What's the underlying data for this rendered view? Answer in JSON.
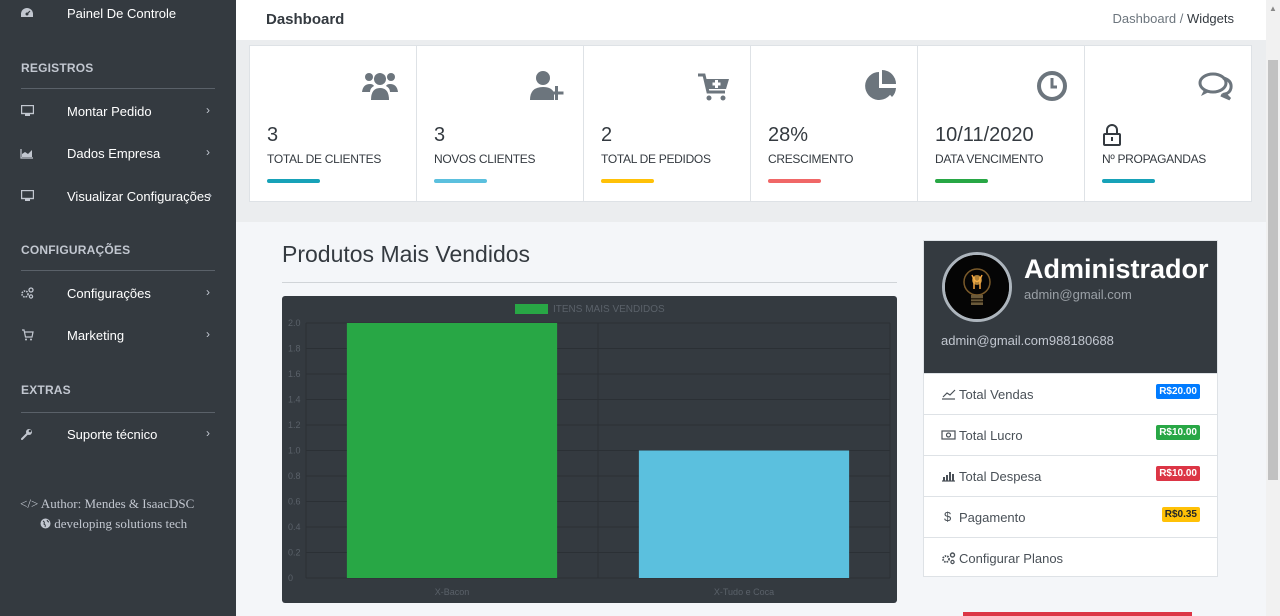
{
  "sidebar": {
    "top_item": {
      "label": "Painel De Controle",
      "icon": "dashboard-icon"
    },
    "sections": [
      {
        "title": "REGISTROS",
        "items": [
          {
            "label": "Montar Pedido",
            "icon": "desktop-icon"
          },
          {
            "label": "Dados Empresa",
            "icon": "area-chart-icon"
          },
          {
            "label": "Visualizar Configurações",
            "icon": "desktop-icon"
          }
        ]
      },
      {
        "title": "CONFIGURAÇÕES",
        "items": [
          {
            "label": "Configurações",
            "icon": "cogs-icon"
          },
          {
            "label": "Marketing",
            "icon": "cart-icon"
          }
        ]
      },
      {
        "title": "EXTRAS",
        "items": [
          {
            "label": "Suporte técnico",
            "icon": "wrench-icon"
          }
        ]
      }
    ],
    "chevron": "›",
    "author_line1": "</> Author: Mendes & IsaacDSC",
    "author_line2": "developing solutions tech"
  },
  "header": {
    "title": "Dashboard",
    "breadcrumb": [
      "Dashboard",
      "/",
      "Widgets"
    ]
  },
  "stats": [
    {
      "value": "3",
      "label": "TOTAL DE CLIENTES",
      "icon": "users-icon",
      "color": "#17a2b8"
    },
    {
      "value": "3",
      "label": "NOVOS CLIENTES",
      "icon": "user-plus-icon",
      "color": "#5bc0de"
    },
    {
      "value": "2",
      "label": "TOTAL DE PEDIDOS",
      "icon": "cart-plus-icon",
      "color": "#ffc107"
    },
    {
      "value": "28%",
      "label": "CRESCIMENTO",
      "icon": "pie-chart-icon",
      "color": "#f06767"
    },
    {
      "value": "10/11/2020",
      "label": "DATA VENCIMENTO",
      "icon": "clock-icon",
      "color": "#28a745"
    },
    {
      "value": "",
      "label": "Nº PROPAGANDAS",
      "icon": "comments-icon",
      "color": "#17a2b8"
    }
  ],
  "panel": {
    "title": "Produtos Mais Vendidos"
  },
  "chart_data": {
    "type": "bar",
    "categories": [
      "X-Bacon",
      "X-Tudo e Coca"
    ],
    "series": [
      {
        "name": "ITENS MAIS VENDIDOS",
        "values": [
          2,
          1
        ]
      }
    ],
    "bar_colors": [
      "#28a745",
      "#5bc0de"
    ],
    "ylim": [
      0,
      2.0
    ],
    "yticks": [
      "2.0",
      "1.8",
      "1.6",
      "1.4",
      "1.2",
      "1.0",
      "0.8",
      "0.6",
      "0.4",
      "0.2",
      "0"
    ],
    "legend": "top"
  },
  "profile": {
    "name": "Administrador",
    "email": "admin@gmail.com",
    "contact": "admin@gmail.com988180688",
    "rows": [
      {
        "label": "Total Vendas",
        "icon": "line-chart-icon",
        "badge": "R$20.00",
        "badge_color": "#007bff",
        "badge_text": "#ffffff"
      },
      {
        "label": "Total Lucro",
        "icon": "money-icon",
        "badge": "R$10.00",
        "badge_color": "#28a745",
        "badge_text": "#ffffff"
      },
      {
        "label": "Total Despesa",
        "icon": "bar-chart-icon",
        "badge": "R$10.00",
        "badge_color": "#dc3545",
        "badge_text": "#ffffff"
      },
      {
        "label": "Pagamento",
        "icon": "dollar-icon",
        "badge": "R$0.35",
        "badge_color": "#ffc107",
        "badge_text": "#212529"
      },
      {
        "label": "Configurar Planos",
        "icon": "cogs-icon",
        "badge": "",
        "badge_color": "",
        "badge_text": ""
      }
    ]
  }
}
